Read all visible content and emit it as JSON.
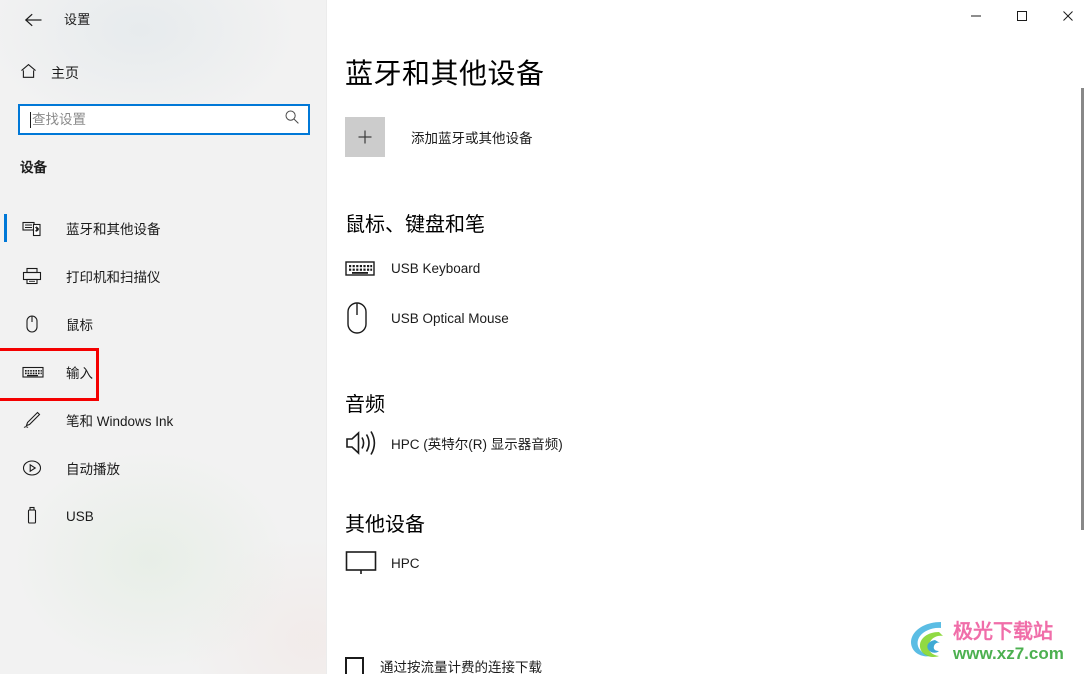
{
  "window": {
    "app_title": "设置",
    "back_icon": "back-arrow-icon",
    "minimize_label": "—",
    "maximize_label": "□",
    "close_label": "✕"
  },
  "sidebar": {
    "home": {
      "label": "主页",
      "icon": "home-icon"
    },
    "search": {
      "value": "",
      "placeholder": "查找设置",
      "icon": "search-icon"
    },
    "section_label": "设备",
    "items": [
      {
        "label": "蓝牙和其他设备",
        "icon": "bluetooth-devices-icon",
        "selected": true,
        "highlighted": false
      },
      {
        "label": "打印机和扫描仪",
        "icon": "printer-icon",
        "selected": false,
        "highlighted": false
      },
      {
        "label": "鼠标",
        "icon": "mouse-icon",
        "selected": false,
        "highlighted": false
      },
      {
        "label": "输入",
        "icon": "keyboard-icon",
        "selected": false,
        "highlighted": true
      },
      {
        "label": "笔和 Windows Ink",
        "icon": "pen-icon",
        "selected": false,
        "highlighted": false
      },
      {
        "label": "自动播放",
        "icon": "autoplay-icon",
        "selected": false,
        "highlighted": false
      },
      {
        "label": "USB",
        "icon": "usb-icon",
        "selected": false,
        "highlighted": false
      }
    ],
    "highlight_color": "#f40000",
    "accent_color": "#0078d7"
  },
  "main": {
    "page_title": "蓝牙和其他设备",
    "add_device": {
      "label": "添加蓝牙或其他设备",
      "icon": "plus-icon"
    },
    "groups": [
      {
        "title": "鼠标、键盘和笔",
        "devices": [
          {
            "name": "USB Keyboard",
            "icon": "keyboard-icon"
          },
          {
            "name": "USB Optical Mouse",
            "icon": "mouse-icon"
          }
        ]
      },
      {
        "title": "音频",
        "devices": [
          {
            "name": "HPC (英特尔(R) 显示器音频)",
            "icon": "speaker-icon"
          }
        ]
      },
      {
        "title": "其他设备",
        "devices": [
          {
            "name": "HPC",
            "icon": "monitor-icon"
          }
        ]
      }
    ],
    "metered": {
      "label": "通过按流量计费的连接下载",
      "checked": false
    }
  },
  "watermark": {
    "title": "极光下载站",
    "url": "www.xz7.com"
  }
}
